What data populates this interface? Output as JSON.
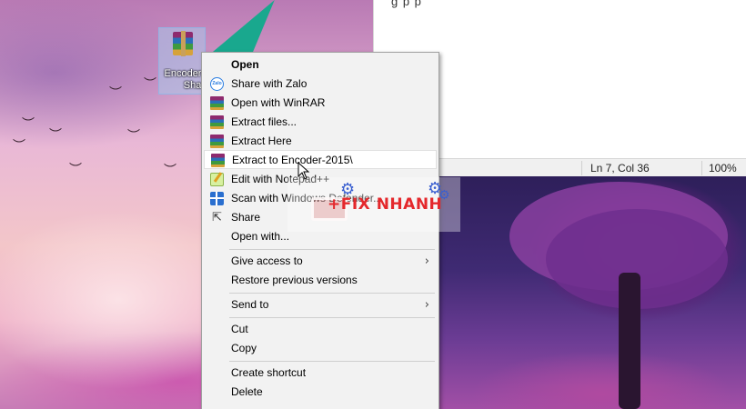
{
  "desktop": {
    "file_icon": {
      "icon": "winrar-archive-icon",
      "label_line1": "Encoder",
      "label_line2": "Shar"
    }
  },
  "notepad": {
    "partial_text": "g p                p",
    "status": {
      "position": "Ln 7, Col 36",
      "zoom": "100%"
    }
  },
  "context_menu": {
    "items": [
      {
        "name": "menu-open",
        "label": "Open",
        "icon": "",
        "bold": true
      },
      {
        "name": "menu-share-zalo",
        "label": "Share with Zalo",
        "icon": "zalo-icon"
      },
      {
        "name": "menu-open-winrar",
        "label": "Open with WinRAR",
        "icon": "winrar-icon"
      },
      {
        "name": "menu-extract-files",
        "label": "Extract files...",
        "icon": "winrar-icon"
      },
      {
        "name": "menu-extract-here",
        "label": "Extract Here",
        "icon": "winrar-icon"
      },
      {
        "name": "menu-extract-to",
        "label": "Extract to Encoder-2015\\",
        "icon": "winrar-icon",
        "hover": true
      },
      {
        "name": "menu-edit-notepadpp",
        "label": "Edit with Notepad++",
        "icon": "notepadpp-icon"
      },
      {
        "name": "menu-scan-defender",
        "label": "Scan with Windows Defender...",
        "icon": "defender-icon"
      },
      {
        "name": "menu-share",
        "label": "Share",
        "icon": "share-icon"
      },
      {
        "name": "menu-open-with",
        "label": "Open with...",
        "icon": ""
      },
      {
        "name": "menu-give-access",
        "label": "Give access to",
        "icon": "",
        "submenu": true
      },
      {
        "name": "menu-restore-versions",
        "label": "Restore previous versions",
        "icon": ""
      },
      {
        "name": "menu-send-to",
        "label": "Send to",
        "icon": "",
        "submenu": true
      },
      {
        "name": "menu-cut",
        "label": "Cut",
        "icon": ""
      },
      {
        "name": "menu-copy",
        "label": "Copy",
        "icon": ""
      },
      {
        "name": "menu-create-shortcut",
        "label": "Create shortcut",
        "icon": ""
      },
      {
        "name": "menu-delete",
        "label": "Delete",
        "icon": ""
      }
    ],
    "submenu_arrow": "›"
  },
  "watermark": {
    "text": "+FIX NHANH"
  }
}
